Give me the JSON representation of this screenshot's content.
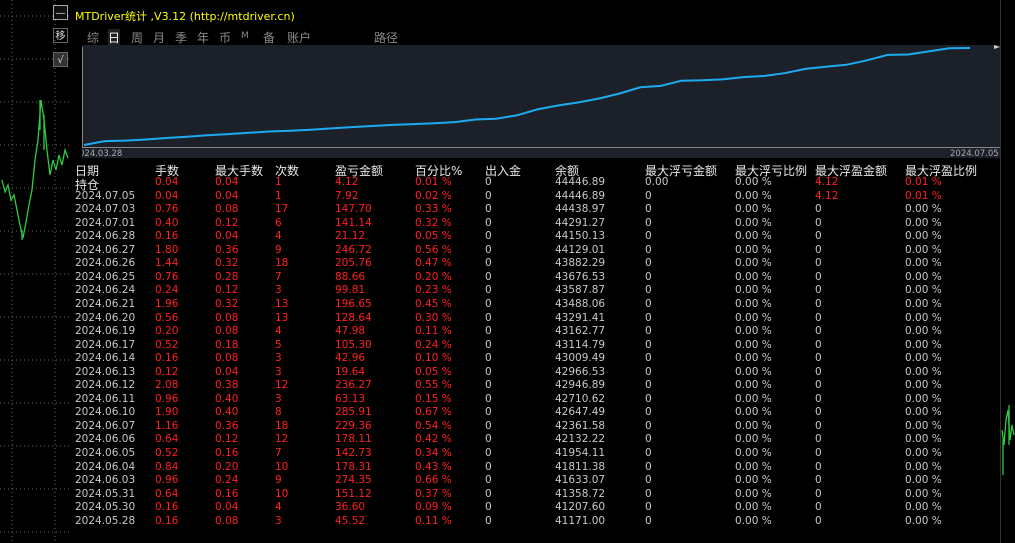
{
  "window": {
    "title": "MTDriver统计 ,V3.12 (http://mtdriver.cn)",
    "min_label": "—",
    "move_label": "移",
    "check_label": "√"
  },
  "tabs": [
    {
      "label": "综",
      "active": false
    },
    {
      "label": "日",
      "active": true
    },
    {
      "label": "周",
      "active": false
    },
    {
      "label": "月",
      "active": false
    },
    {
      "label": "季",
      "active": false
    },
    {
      "label": "年",
      "active": false
    },
    {
      "label": "币",
      "active": false
    },
    {
      "label": "M",
      "active": false
    },
    {
      "label": "备",
      "active": false
    },
    {
      "label": "账户",
      "active": false
    },
    {
      "label": "路径",
      "active": false
    }
  ],
  "chart_data": {
    "type": "line",
    "x_start_label": "024.03.28",
    "x_end_label": "2024.07.05",
    "line_color": "#1eaaf0",
    "values": [
      40000,
      40180,
      40200,
      40250,
      40320,
      40380,
      40450,
      40500,
      40560,
      40620,
      40650,
      40700,
      40760,
      40820,
      40870,
      40920,
      40960,
      41000,
      41050,
      41171,
      41207.6,
      41358.72,
      41633.07,
      41811.38,
      41954.11,
      42132.22,
      42361.58,
      42647.49,
      42710.62,
      42946.89,
      42966.53,
      43009.49,
      43114.79,
      43162.77,
      43291.41,
      43488.06,
      43587.87,
      43676.53,
      43882.29,
      44129.01,
      44150.13,
      44291.27,
      44438.97,
      44446.89
    ]
  },
  "table": {
    "headers": [
      "日期",
      "手数",
      "最大手数",
      "次数",
      "盈亏金额",
      "百分比%",
      "出入金",
      "余额",
      "最大浮亏金额",
      "最大浮亏比例",
      "最大浮盈金额",
      "最大浮盈比例"
    ],
    "rows": [
      [
        "持仓",
        "0.04",
        "0.04",
        "1",
        "4.12",
        "0.01 %",
        "0",
        "44446.89",
        "0.00",
        "0.00 %",
        "4.12",
        "0.01 %"
      ],
      [
        "2024.07.05",
        "0.04",
        "0.04",
        "1",
        "7.92",
        "0.02 %",
        "0",
        "44446.89",
        "0",
        "0.00 %",
        "4.12",
        "0.01 %"
      ],
      [
        "2024.07.03",
        "0.76",
        "0.08",
        "17",
        "147.70",
        "0.33 %",
        "0",
        "44438.97",
        "0",
        "0.00 %",
        "0",
        "0.00 %"
      ],
      [
        "2024.07.01",
        "0.40",
        "0.12",
        "6",
        "141.14",
        "0.32 %",
        "0",
        "44291.27",
        "0",
        "0.00 %",
        "0",
        "0.00 %"
      ],
      [
        "2024.06.28",
        "0.16",
        "0.04",
        "4",
        "21.12",
        "0.05 %",
        "0",
        "44150.13",
        "0",
        "0.00 %",
        "0",
        "0.00 %"
      ],
      [
        "2024.06.27",
        "1.80",
        "0.36",
        "9",
        "246.72",
        "0.56 %",
        "0",
        "44129.01",
        "0",
        "0.00 %",
        "0",
        "0.00 %"
      ],
      [
        "2024.06.26",
        "1.44",
        "0.32",
        "18",
        "205.76",
        "0.47 %",
        "0",
        "43882.29",
        "0",
        "0.00 %",
        "0",
        "0.00 %"
      ],
      [
        "2024.06.25",
        "0.76",
        "0.28",
        "7",
        "88.66",
        "0.20 %",
        "0",
        "43676.53",
        "0",
        "0.00 %",
        "0",
        "0.00 %"
      ],
      [
        "2024.06.24",
        "0.24",
        "0.12",
        "3",
        "99.81",
        "0.23 %",
        "0",
        "43587.87",
        "0",
        "0.00 %",
        "0",
        "0.00 %"
      ],
      [
        "2024.06.21",
        "1.96",
        "0.32",
        "13",
        "196.65",
        "0.45 %",
        "0",
        "43488.06",
        "0",
        "0.00 %",
        "0",
        "0.00 %"
      ],
      [
        "2024.06.20",
        "0.56",
        "0.08",
        "13",
        "128.64",
        "0.30 %",
        "0",
        "43291.41",
        "0",
        "0.00 %",
        "0",
        "0.00 %"
      ],
      [
        "2024.06.19",
        "0.20",
        "0.08",
        "4",
        "47.98",
        "0.11 %",
        "0",
        "43162.77",
        "0",
        "0.00 %",
        "0",
        "0.00 %"
      ],
      [
        "2024.06.17",
        "0.52",
        "0.18",
        "5",
        "105.30",
        "0.24 %",
        "0",
        "43114.79",
        "0",
        "0.00 %",
        "0",
        "0.00 %"
      ],
      [
        "2024.06.14",
        "0.16",
        "0.08",
        "3",
        "42.96",
        "0.10 %",
        "0",
        "43009.49",
        "0",
        "0.00 %",
        "0",
        "0.00 %"
      ],
      [
        "2024.06.13",
        "0.12",
        "0.04",
        "3",
        "19.64",
        "0.05 %",
        "0",
        "42966.53",
        "0",
        "0.00 %",
        "0",
        "0.00 %"
      ],
      [
        "2024.06.12",
        "2.08",
        "0.38",
        "12",
        "236.27",
        "0.55 %",
        "0",
        "42946.89",
        "0",
        "0.00 %",
        "0",
        "0.00 %"
      ],
      [
        "2024.06.11",
        "0.96",
        "0.40",
        "3",
        "63.13",
        "0.15 %",
        "0",
        "42710.62",
        "0",
        "0.00 %",
        "0",
        "0.00 %"
      ],
      [
        "2024.06.10",
        "1.90",
        "0.40",
        "8",
        "285.91",
        "0.67 %",
        "0",
        "42647.49",
        "0",
        "0.00 %",
        "0",
        "0.00 %"
      ],
      [
        "2024.06.07",
        "1.16",
        "0.36",
        "18",
        "229.36",
        "0.54 %",
        "0",
        "42361.58",
        "0",
        "0.00 %",
        "0",
        "0.00 %"
      ],
      [
        "2024.06.06",
        "0.64",
        "0.12",
        "12",
        "178.11",
        "0.42 %",
        "0",
        "42132.22",
        "0",
        "0.00 %",
        "0",
        "0.00 %"
      ],
      [
        "2024.06.05",
        "0.52",
        "0.16",
        "7",
        "142.73",
        "0.34 %",
        "0",
        "41954.11",
        "0",
        "0.00 %",
        "0",
        "0.00 %"
      ],
      [
        "2024.06.04",
        "0.84",
        "0.20",
        "10",
        "178.31",
        "0.43 %",
        "0",
        "41811.38",
        "0",
        "0.00 %",
        "0",
        "0.00 %"
      ],
      [
        "2024.06.03",
        "0.96",
        "0.24",
        "9",
        "274.35",
        "0.66 %",
        "0",
        "41633.07",
        "0",
        "0.00 %",
        "0",
        "0.00 %"
      ],
      [
        "2024.05.31",
        "0.64",
        "0.16",
        "10",
        "151.12",
        "0.37 %",
        "0",
        "41358.72",
        "0",
        "0.00 %",
        "0",
        "0.00 %"
      ],
      [
        "2024.05.30",
        "0.16",
        "0.04",
        "4",
        "36.60",
        "0.09 %",
        "0",
        "41207.60",
        "0",
        "0.00 %",
        "0",
        "0.00 %"
      ],
      [
        "2024.05.28",
        "0.16",
        "0.08",
        "3",
        "45.52",
        "0.11 %",
        "0",
        "41171.00",
        "0",
        "0.00 %",
        "0",
        "0.00 %"
      ]
    ]
  },
  "colors": {
    "accent_red": "#ff2020",
    "header_text": "#e8e8e8",
    "title_yellow": "#ffff00",
    "chart_bg": "#1c2129",
    "chart_line": "#1eaaf0"
  }
}
